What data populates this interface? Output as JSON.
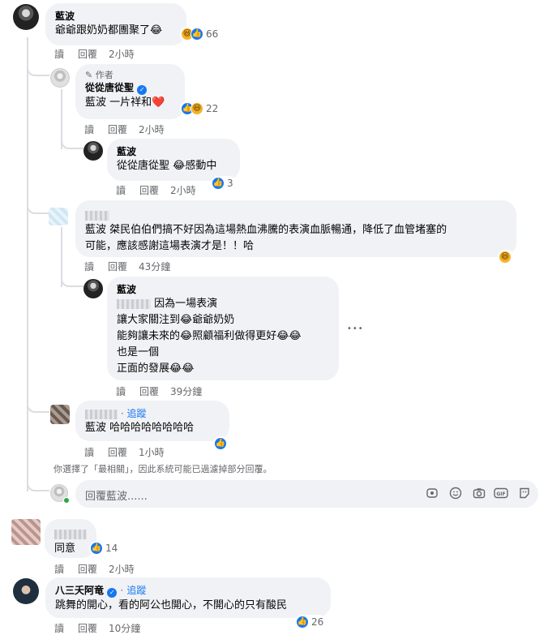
{
  "comments": [
    {
      "name": "藍波",
      "text": "爺爺跟奶奶都團聚了😂",
      "reaction_count": "66",
      "read": "讀",
      "reply": "回覆",
      "time": "2小時"
    },
    {
      "author_badge": "作者",
      "name": "從從唐從聖",
      "text": "藍波 一片祥和❤️",
      "reaction_count": "22",
      "read": "讀",
      "reply": "回覆",
      "time": "2小時"
    },
    {
      "name": "藍波",
      "text": "從從唐從聖 😂感動中",
      "reaction_count": "3",
      "read": "讀",
      "reply": "回覆",
      "time": "2小時"
    },
    {
      "text_line1": "藍波 桀民伯伯們搞不好因為這場熱血沸騰的表演血脈暢通，降低了血管堵塞的",
      "text_line2": "可能，應該感謝這場表演才是！！哈",
      "read": "讀",
      "reply": "回覆",
      "time": "43分鐘"
    },
    {
      "name": "藍波",
      "line1": "因為一場表演",
      "line2": "讓大家關注到😂爺爺奶奶",
      "line3": "能夠讓未來的😂照顧福利做得更好😂😂",
      "line4": "也是一個",
      "line5": "正面的發展😂😂",
      "read": "讀",
      "reply": "回覆",
      "time": "39分鐘"
    },
    {
      "follow": "追蹤",
      "text": "藍波 哈哈哈哈哈哈哈哈",
      "read": "讀",
      "reply": "回覆",
      "time": "1小時"
    },
    {
      "text": "同意",
      "reaction_count": "14",
      "read": "讀",
      "reply": "回覆",
      "time": "2小時"
    },
    {
      "name": "八三夭阿竜",
      "follow": "追蹤",
      "text": "跳舞的開心，看的阿公也開心，不開心的只有酸民",
      "reaction_count": "26",
      "read": "讀",
      "reply": "回覆",
      "time": "10分鐘"
    }
  ],
  "filter_notice": "你選擇了「最相關」，因此系統可能已過濾掉部分回覆。",
  "reply_placeholder": "回覆藍波......",
  "more_dots": "•••",
  "separator_dot": "·",
  "icons": {
    "emoji": "emoji-icon",
    "camera": "camera-icon",
    "gif": "gif-icon",
    "sticker": "sticker-icon",
    "avatar_frame": "avatar-frame-icon",
    "pencil": "pencil-icon"
  },
  "colors": {
    "accent": "#1877f2",
    "bubble": "#f0f2f5",
    "muted": "#65676b",
    "heart": "#e41e3f"
  }
}
